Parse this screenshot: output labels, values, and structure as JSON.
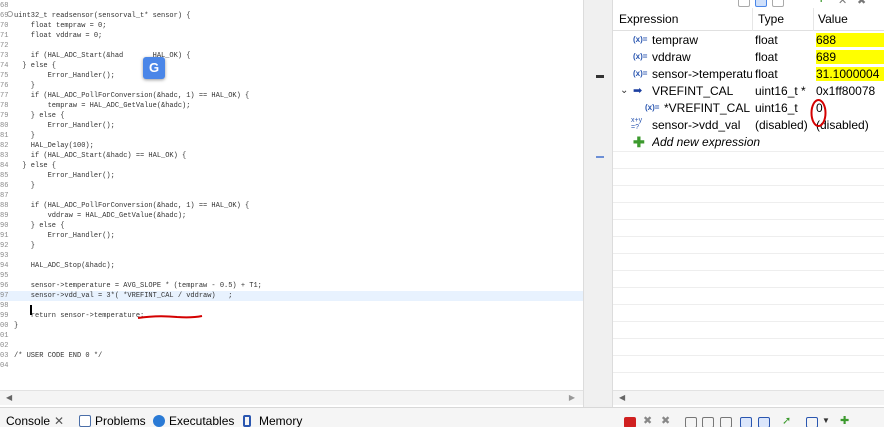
{
  "editor": {
    "lines": [
      {
        "n": "68",
        "t": ""
      },
      {
        "n": "69",
        "t": "uint32_t readsensor(sensorval_t* sensor) {"
      },
      {
        "n": "70",
        "t": "    float tempraw = 0;"
      },
      {
        "n": "71",
        "t": "    float vddraw = 0;"
      },
      {
        "n": "72",
        "t": ""
      },
      {
        "n": "73",
        "t": "    if (HAL_ADC_Start(&had       HAL_OK) {"
      },
      {
        "n": "74",
        "t": "  } else {"
      },
      {
        "n": "75",
        "t": "        Error_Handler();"
      },
      {
        "n": "76",
        "t": "    }"
      },
      {
        "n": "77",
        "t": "    if (HAL_ADC_PollForConversion(&hadc, 1) == HAL_OK) {"
      },
      {
        "n": "78",
        "t": "        tempraw = HAL_ADC_GetValue(&hadc);"
      },
      {
        "n": "79",
        "t": "    } else {"
      },
      {
        "n": "80",
        "t": "        Error_Handler();"
      },
      {
        "n": "81",
        "t": "    }"
      },
      {
        "n": "82",
        "t": "    HAL_Delay(100);"
      },
      {
        "n": "83",
        "t": "    if (HAL_ADC_Start(&hadc) == HAL_OK) {"
      },
      {
        "n": "84",
        "t": "  } else {"
      },
      {
        "n": "85",
        "t": "        Error_Handler();"
      },
      {
        "n": "86",
        "t": "    }"
      },
      {
        "n": "87",
        "t": ""
      },
      {
        "n": "88",
        "t": "    if (HAL_ADC_PollForConversion(&hadc, 1) == HAL_OK) {"
      },
      {
        "n": "89",
        "t": "        vddraw = HAL_ADC_GetValue(&hadc);"
      },
      {
        "n": "90",
        "t": "    } else {"
      },
      {
        "n": "91",
        "t": "        Error_Handler();"
      },
      {
        "n": "92",
        "t": "    }"
      },
      {
        "n": "93",
        "t": ""
      },
      {
        "n": "94",
        "t": "    HAL_ADC_Stop(&hadc);"
      },
      {
        "n": "95",
        "t": ""
      },
      {
        "n": "96",
        "t": "    sensor->temperature = AVG_SLOPE * (tempraw - 0.5) + T1;"
      },
      {
        "n": "97",
        "t": "    sensor->vdd_val = 3*( *VREFINT_CAL / vddraw)   ;"
      },
      {
        "n": "98",
        "t": ""
      },
      {
        "n": "99",
        "t": "    return sensor->temperature;"
      },
      {
        "n": "00",
        "t": "}"
      },
      {
        "n": "01",
        "t": ""
      },
      {
        "n": "02",
        "t": ""
      },
      {
        "n": "03",
        "t": "/* USER CODE END 0 */"
      },
      {
        "n": "04",
        "t": ""
      }
    ],
    "translate_badge": "G"
  },
  "expressions": {
    "headers": {
      "expression": "Expression",
      "type": "Type",
      "value": "Value"
    },
    "rows": [
      {
        "icon": "(x)=",
        "expression": "tempraw",
        "type": "float",
        "value": "688",
        "highlight": true
      },
      {
        "icon": "(x)=",
        "expression": "vddraw",
        "type": "float",
        "value": "689",
        "highlight": true
      },
      {
        "icon": "(x)=",
        "expression": "sensor->temperatu",
        "type": "float",
        "value": "31.1000004",
        "highlight": true
      },
      {
        "icon": "arrow",
        "expression": "VREFINT_CAL",
        "type": "uint16_t *",
        "value": "0x1ff80078",
        "highlight": false
      },
      {
        "icon": "(x)=",
        "expression": "*VREFINT_CAL",
        "type": "uint16_t",
        "value": "0",
        "highlight": false
      },
      {
        "icon": "x+y",
        "expression": "sensor->vdd_val",
        "type": "(disabled)",
        "value": "(disabled)",
        "highlight": false
      }
    ],
    "add_new": "Add new expression"
  },
  "bottom_tabs": {
    "console": "Console",
    "problems": "Problems",
    "executables": "Executables",
    "memory": "Memory"
  },
  "colors": {
    "highlight": "#ffff00",
    "annotation_red": "#d40000"
  }
}
